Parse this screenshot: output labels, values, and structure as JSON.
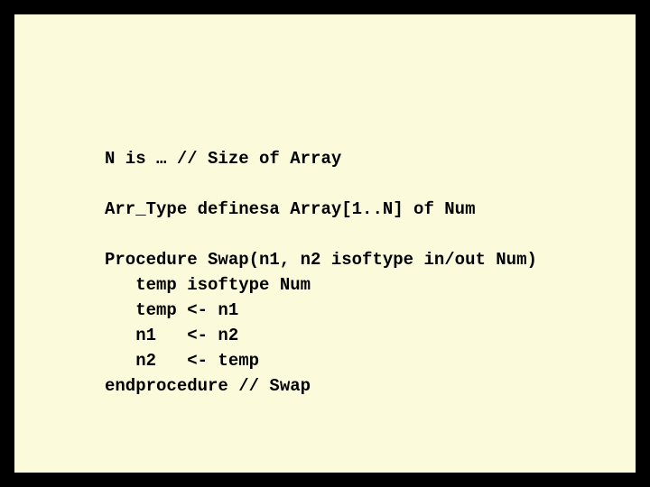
{
  "code": {
    "line1": "N is … // Size of Array",
    "blank1": "",
    "line2": "Arr_Type definesa Array[1..N] of Num",
    "blank2": "",
    "line3": "Procedure Swap(n1, n2 isoftype in/out Num)",
    "line4": "   temp isoftype Num",
    "line5": "   temp <- n1",
    "line6": "   n1   <- n2",
    "line7": "   n2   <- temp",
    "line8": "endprocedure // Swap"
  }
}
